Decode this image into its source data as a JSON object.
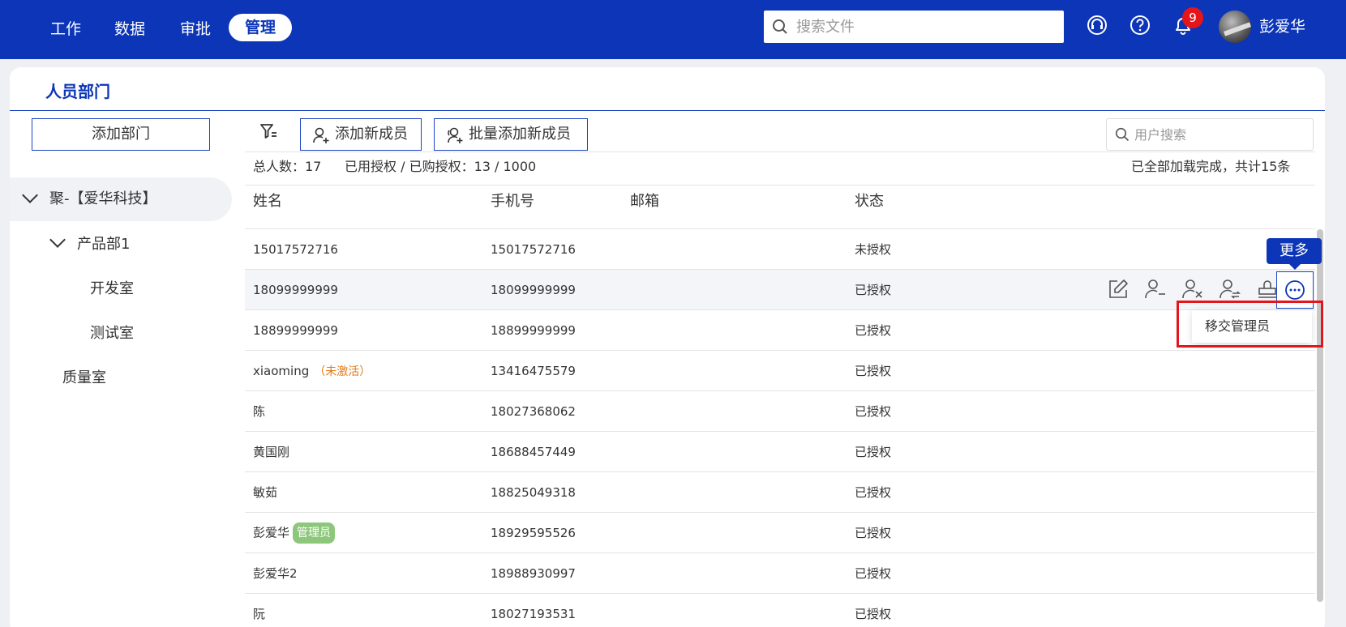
{
  "nav": {
    "items": [
      {
        "label": "工作"
      },
      {
        "label": "数据"
      },
      {
        "label": "审批"
      },
      {
        "label": "管理"
      }
    ],
    "search_placeholder": "搜索文件",
    "notification_count": "9",
    "username": "彭爱华"
  },
  "page": {
    "title": "人员部门",
    "add_dept_label": "添加部门",
    "tree": {
      "root": "聚-【爱华科技】",
      "children": [
        {
          "label": "产品部1",
          "children": [
            {
              "label": "开发室"
            },
            {
              "label": "测试室"
            }
          ]
        },
        {
          "label": "质量室"
        }
      ]
    }
  },
  "toolbar": {
    "add_member_label": "添加新成员",
    "batch_add_label": "批量添加新成员",
    "user_search_placeholder": "用户搜索"
  },
  "stats": {
    "total": "总人数：17",
    "license": "已用授权 / 已购授权：13 / 1000",
    "loaded": "已全部加载完成，共计15条"
  },
  "table": {
    "headers": {
      "name": "姓名",
      "phone": "手机号",
      "email": "邮箱",
      "status": "状态"
    },
    "rows": [
      {
        "name": "15017572716",
        "phone": "15017572716",
        "status": "未授权"
      },
      {
        "name": "18099999999",
        "phone": "18099999999",
        "status": "已授权"
      },
      {
        "name": "18899999999",
        "phone": "18899999999",
        "status": "已授权"
      },
      {
        "name": "xiaoming",
        "note": "（未激活）",
        "phone": "13416475579",
        "status": "已授权"
      },
      {
        "name": "陈",
        "phone": "18027368062",
        "status": "已授权"
      },
      {
        "name": "黄国刚",
        "phone": "18688457449",
        "status": "已授权"
      },
      {
        "name": "敏茹",
        "phone": "18825049318",
        "status": "已授权"
      },
      {
        "name": "彭爱华",
        "tag": "管理员",
        "phone": "18929595526",
        "status": "已授权"
      },
      {
        "name": "彭爱华2",
        "phone": "18988930997",
        "status": "已授权"
      },
      {
        "name": "阮",
        "phone": "18027193531",
        "status": "已授权"
      }
    ]
  },
  "tooltip": {
    "more_label": "更多"
  },
  "dropdown": {
    "transfer_admin": "移交管理员"
  },
  "colors": {
    "primary": "#0c35b8",
    "highlight": "#e5151c",
    "admin_tag": "#8dc77b",
    "inactive": "#e07b1a"
  }
}
